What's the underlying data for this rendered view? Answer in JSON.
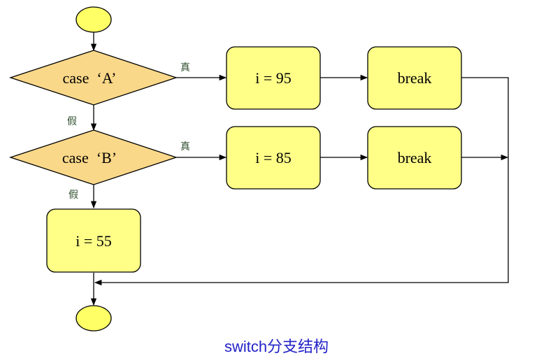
{
  "colors": {
    "decision_fill": "#fad889",
    "process_fill": "#ffff88",
    "terminal_fill": "#ffff66",
    "stroke": "#000000",
    "caption": "#2323c8"
  },
  "nodes": {
    "start": "",
    "case_a": "case  ‘A’",
    "case_b": "case  ‘B’",
    "assign_95": "i = 95",
    "break_1": "break",
    "assign_85": "i = 85",
    "break_2": "break",
    "assign_55": "i = 55",
    "end": ""
  },
  "edge_labels": {
    "case_a_true": "真",
    "case_a_false": "假",
    "case_b_true": "真",
    "case_b_false": "假"
  },
  "caption": "switch分支结构"
}
